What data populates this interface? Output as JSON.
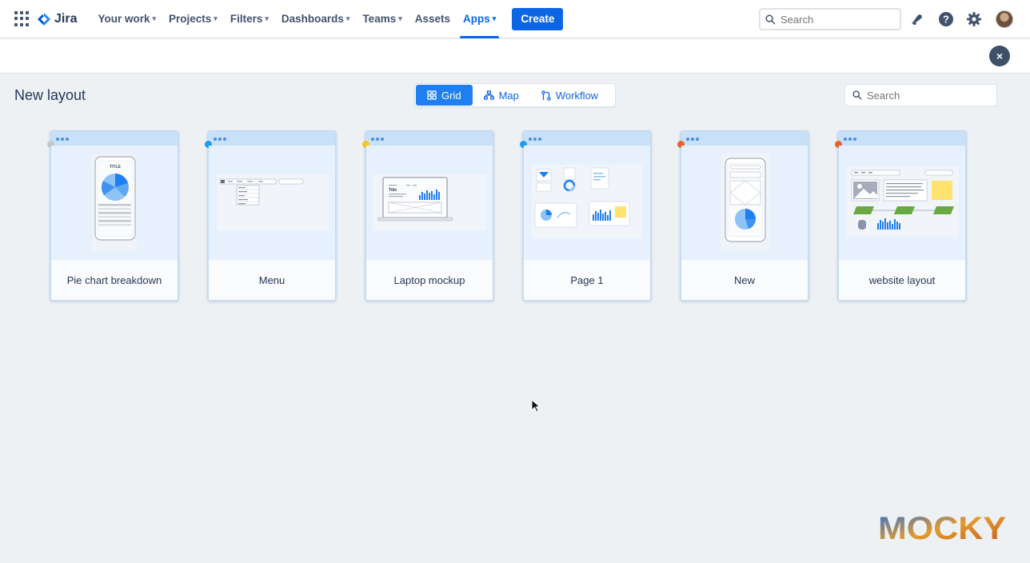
{
  "nav": {
    "brand": "Jira",
    "items": [
      {
        "label": "Your work",
        "chevron": true,
        "active": false
      },
      {
        "label": "Projects",
        "chevron": true,
        "active": false
      },
      {
        "label": "Filters",
        "chevron": true,
        "active": false
      },
      {
        "label": "Dashboards",
        "chevron": true,
        "active": false
      },
      {
        "label": "Teams",
        "chevron": true,
        "active": false
      },
      {
        "label": "Assets",
        "chevron": false,
        "active": false
      },
      {
        "label": "Apps",
        "chevron": true,
        "active": true
      }
    ],
    "create_label": "Create",
    "search_placeholder": "Search",
    "icons": [
      "app-switcher-icon",
      "jira-logo-icon",
      "notification-bell-icon",
      "help-icon",
      "settings-gear-icon",
      "avatar"
    ],
    "accent_color": "#0c66e4"
  },
  "page": {
    "title": "New layout",
    "close_label": "×",
    "search_placeholder": "Search",
    "view_switch": [
      {
        "label": "Grid",
        "icon": "grid-icon",
        "active": true
      },
      {
        "label": "Map",
        "icon": "map-icon",
        "active": false
      },
      {
        "label": "Workflow",
        "icon": "workflow-icon",
        "active": false
      }
    ]
  },
  "cards": [
    {
      "label": "Pie chart breakdown",
      "status_color": "#c1c7d0",
      "preview": "phone-pie",
      "preview_title": "TITLE"
    },
    {
      "label": "Menu",
      "status_color": "#1d9bf0",
      "preview": "menu"
    },
    {
      "label": "Laptop mockup",
      "status_color": "#f5c518",
      "preview": "laptop",
      "preview_title": "Title"
    },
    {
      "label": "Page 1",
      "status_color": "#1d9bf0",
      "preview": "dashboard"
    },
    {
      "label": "New",
      "status_color": "#e8632b",
      "preview": "phone-new"
    },
    {
      "label": "website layout",
      "status_color": "#e8632b",
      "preview": "website"
    }
  ],
  "watermark": "MOCKY"
}
